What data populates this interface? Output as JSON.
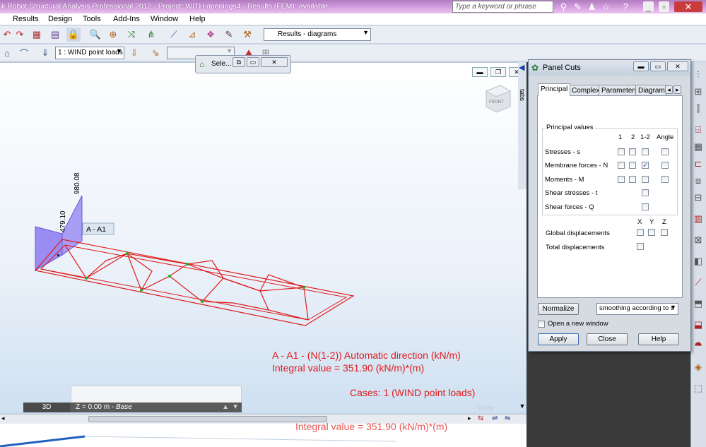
{
  "title_bar": {
    "title": "k Robot Structural Analysis Professional 2012 - Project: WITH openings4 - Results (FEM): available",
    "search_placeholder": "Type a keyword or phrase"
  },
  "menu": [
    "Results",
    "Design",
    "Tools",
    "Add-Ins",
    "Window",
    "Help"
  ],
  "toolbar": {
    "layout_combo": "Results - diagrams",
    "load_case_combo": "1 : WIND point loads"
  },
  "select_window": {
    "label": "Sele..."
  },
  "view": {
    "cube_label": "FRONT",
    "diagram_value_1": "980.08",
    "diagram_value_2": "479.10",
    "cut_label": "A - A1",
    "result_line1": "A - A1 - (N(1-2)) Automatic direction (kN/m)",
    "result_line2": "Integral value = 351.90 (kN/m)*(m)",
    "cases_line": "Cases: 1 (WIND point loads)",
    "view_tab": "3D",
    "z_prefix": "Z = 0.00 m - ",
    "z_level": "Base",
    "ghost_text": "Integral value = 351.90 (kN/m)*(m)",
    "faded_label": "View"
  },
  "tabs_strip": "tabs",
  "dialog": {
    "title": "Panel Cuts",
    "tabs": [
      "Principal",
      "Complex",
      "Parameters",
      "Diagrams"
    ],
    "group_title": "Principal values",
    "col_headers": [
      "1",
      "2",
      "1-2",
      "Angle"
    ],
    "rows": [
      {
        "label": "Stresses - s",
        "checked": [
          false,
          false,
          false,
          false
        ]
      },
      {
        "label": "Membrane forces - N",
        "checked": [
          false,
          false,
          true,
          false
        ]
      },
      {
        "label": "Moments - M",
        "checked": [
          false,
          false,
          false,
          false
        ]
      },
      {
        "label": "Shear stresses - t",
        "checked": [
          false
        ]
      },
      {
        "label": "Shear forces - Q",
        "checked": [
          false
        ]
      }
    ],
    "xyz_headers": [
      "X",
      "Y",
      "Z"
    ],
    "global_displacements": "Global displacements",
    "total_displacements": "Total displacements",
    "normalize": "Normalize",
    "smoothing": "smoothing according to s",
    "open_new_window": "Open a new window",
    "apply": "Apply",
    "close": "Close",
    "help": "Help"
  },
  "colors": {
    "diagram_fill": "#9a8cf0",
    "mesh_red": "#e01a1a",
    "node_green": "#22aa22"
  }
}
